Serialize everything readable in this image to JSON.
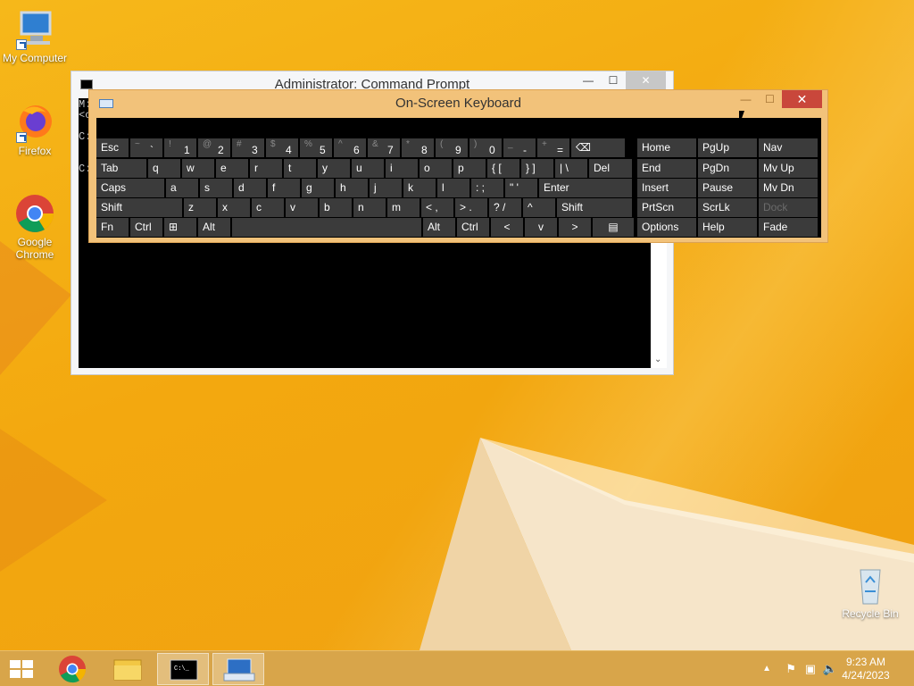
{
  "desktop": {
    "icons": [
      {
        "label": "My Computer"
      },
      {
        "label": "Firefox"
      },
      {
        "label": "Google Chrome"
      },
      {
        "label": "Recycle Bin"
      }
    ]
  },
  "cmd_window": {
    "title": "Administrator:  Command Prompt",
    "lines": [
      "M:",
      "<c",
      "C:",
      "C:"
    ]
  },
  "osk": {
    "title": "On-Screen Keyboard",
    "row1": [
      {
        "main": "Esc"
      },
      {
        "shift": "~",
        "main": "`"
      },
      {
        "shift": "!",
        "main": "1"
      },
      {
        "shift": "@",
        "main": "2"
      },
      {
        "shift": "#",
        "main": "3"
      },
      {
        "shift": "$",
        "main": "4"
      },
      {
        "shift": "%",
        "main": "5"
      },
      {
        "shift": "^",
        "main": "6"
      },
      {
        "shift": "&",
        "main": "7"
      },
      {
        "shift": "*",
        "main": "8"
      },
      {
        "shift": "(",
        "main": "9"
      },
      {
        "shift": ")",
        "main": "0"
      },
      {
        "shift": "_",
        "main": "-"
      },
      {
        "shift": "+",
        "main": "="
      },
      {
        "main": "⌫"
      }
    ],
    "row2": [
      "Tab",
      "q",
      "w",
      "e",
      "r",
      "t",
      "y",
      "u",
      "i",
      "o",
      "p",
      "{ [",
      "} ]",
      "| \\",
      "Del"
    ],
    "row3": [
      "Caps",
      "a",
      "s",
      "d",
      "f",
      "g",
      "h",
      "j",
      "k",
      "l",
      ": ;",
      "\" '",
      "Enter"
    ],
    "row4": [
      "Shift",
      "z",
      "x",
      "c",
      "v",
      "b",
      "n",
      "m",
      "< ,",
      "> .",
      "? /",
      "^",
      "Shift"
    ],
    "row5": [
      "Fn",
      "Ctrl",
      "⊞",
      "Alt",
      "",
      "Alt",
      "Ctrl",
      "<",
      "v",
      ">",
      "▤"
    ],
    "nav": [
      [
        "Home",
        "PgUp",
        "Nav"
      ],
      [
        "End",
        "PgDn",
        "Mv Up"
      ],
      [
        "Insert",
        "Pause",
        "Mv Dn"
      ],
      [
        "PrtScn",
        "ScrLk",
        "Dock"
      ],
      [
        "Options",
        "Help",
        "Fade"
      ]
    ]
  },
  "taskbar": {
    "time": "9:23 AM",
    "date": "4/24/2023"
  },
  "colors": {
    "accent": "#f3a80f",
    "osk_frame": "#f2c27a",
    "close_red": "#c9473b"
  }
}
